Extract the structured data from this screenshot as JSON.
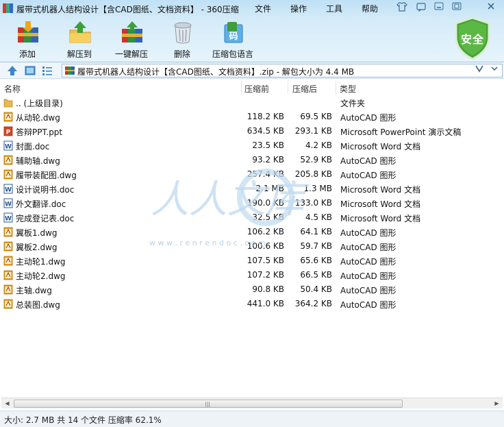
{
  "window": {
    "title": "履带式机器人结构设计【含CAD图纸、文档资料】 - 360压缩",
    "menu": [
      "文件",
      "操作",
      "工具",
      "帮助"
    ]
  },
  "toolbar": {
    "items": [
      {
        "label": "添加",
        "icon": "add-archive-icon"
      },
      {
        "label": "解压到",
        "icon": "extract-to-icon"
      },
      {
        "label": "一键解压",
        "icon": "one-click-extract-icon"
      },
      {
        "label": "删除",
        "icon": "delete-bin-icon"
      },
      {
        "label": "压缩包语言",
        "icon": "archive-language-icon"
      }
    ],
    "language_badge": "码",
    "security_badge": "安全"
  },
  "address": {
    "text": "履带式机器人结构设计【含CAD图纸、文档资料】.zip - 解包大小为 4.4 MB"
  },
  "columns": {
    "name": "名称",
    "compressed": "压缩前",
    "uncompressed": "压缩后",
    "type": "类型"
  },
  "files": [
    {
      "name": ".. (上级目录)",
      "before": "",
      "after": "",
      "type": "文件夹",
      "kind": "folder"
    },
    {
      "name": "从动轮.dwg",
      "before": "118.2 KB",
      "after": "69.5 KB",
      "type": "AutoCAD 图形",
      "kind": "dwg"
    },
    {
      "name": "答辩PPT.ppt",
      "before": "634.5 KB",
      "after": "293.1 KB",
      "type": "Microsoft PowerPoint 演示文稿",
      "kind": "ppt"
    },
    {
      "name": "封面.doc",
      "before": "23.5 KB",
      "after": "4.2 KB",
      "type": "Microsoft Word 文档",
      "kind": "doc"
    },
    {
      "name": "辅助轴.dwg",
      "before": "93.2 KB",
      "after": "52.9 KB",
      "type": "AutoCAD 图形",
      "kind": "dwg"
    },
    {
      "name": "履带装配图.dwg",
      "before": "257.4 KB",
      "after": "205.8 KB",
      "type": "AutoCAD 图形",
      "kind": "dwg"
    },
    {
      "name": "设计说明书.doc",
      "before": "2.1 MB",
      "after": "1.3 MB",
      "type": "Microsoft Word 文档",
      "kind": "doc"
    },
    {
      "name": "外文翻译.doc",
      "before": "190.0 KB",
      "after": "133.0 KB",
      "type": "Microsoft Word 文档",
      "kind": "doc"
    },
    {
      "name": "完成登记表.doc",
      "before": "32.5 KB",
      "after": "4.5 KB",
      "type": "Microsoft Word 文档",
      "kind": "doc"
    },
    {
      "name": "翼板1.dwg",
      "before": "106.2 KB",
      "after": "64.1 KB",
      "type": "AutoCAD 图形",
      "kind": "dwg"
    },
    {
      "name": "翼板2.dwg",
      "before": "100.6 KB",
      "after": "59.7 KB",
      "type": "AutoCAD 图形",
      "kind": "dwg"
    },
    {
      "name": "主动轮1.dwg",
      "before": "107.5 KB",
      "after": "65.6 KB",
      "type": "AutoCAD 图形",
      "kind": "dwg"
    },
    {
      "name": "主动轮2.dwg",
      "before": "107.2 KB",
      "after": "66.5 KB",
      "type": "AutoCAD 图形",
      "kind": "dwg"
    },
    {
      "name": "主轴.dwg",
      "before": "90.8 KB",
      "after": "50.4 KB",
      "type": "AutoCAD 图形",
      "kind": "dwg"
    },
    {
      "name": "总装图.dwg",
      "before": "441.0 KB",
      "after": "364.2 KB",
      "type": "AutoCAD 图形",
      "kind": "dwg"
    }
  ],
  "watermark": {
    "text": "人人文库",
    "url": "w w w . r e n r e n d o c . c o m"
  },
  "status": {
    "text": "大小: 2.7 MB 共 14 个文件 压缩率 62.1%"
  },
  "colors": {
    "dwg": "#e8a317",
    "doc": "#2b5797",
    "ppt": "#d24726",
    "folder": "#e9b94a",
    "shield": "#4aa336"
  }
}
